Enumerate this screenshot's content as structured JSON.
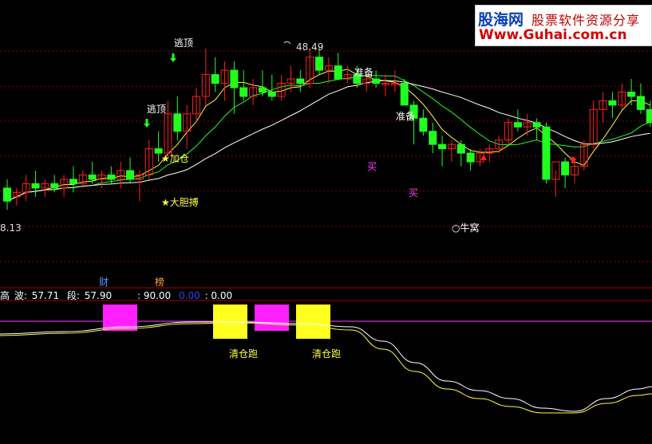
{
  "chart_data": [
    {
      "type": "candlestick",
      "title": "",
      "price_labels": {
        "high": "48.49",
        "low": "8.13"
      },
      "ylim": [
        8,
        52
      ],
      "up_color": "#ff2020",
      "down_color": "#20ff20",
      "candles": [
        [
          16,
          18,
          11,
          13
        ],
        [
          14,
          16,
          12,
          15
        ],
        [
          15,
          19,
          13,
          17
        ],
        [
          17,
          20,
          14,
          16
        ],
        [
          16,
          18,
          14,
          17
        ],
        [
          17,
          19,
          15,
          16
        ],
        [
          16,
          19,
          14,
          18
        ],
        [
          18,
          21,
          15,
          17
        ],
        [
          17,
          20,
          16,
          19
        ],
        [
          19,
          22,
          17,
          18
        ],
        [
          18,
          20,
          16,
          19
        ],
        [
          19,
          21,
          17,
          18
        ],
        [
          18,
          22,
          16,
          20
        ],
        [
          20,
          23,
          17,
          18
        ],
        [
          18,
          20,
          13,
          19
        ],
        [
          19,
          27,
          18,
          25
        ],
        [
          25,
          29,
          22,
          24
        ],
        [
          24,
          36,
          23,
          33
        ],
        [
          33,
          37,
          27,
          29
        ],
        [
          29,
          35,
          25,
          33
        ],
        [
          33,
          39,
          31,
          37
        ],
        [
          37,
          48,
          35,
          42
        ],
        [
          42,
          46,
          38,
          40
        ],
        [
          40,
          45,
          36,
          43
        ],
        [
          43,
          45,
          33,
          39
        ],
        [
          39,
          43,
          36,
          37
        ],
        [
          37,
          41,
          35,
          39
        ],
        [
          39,
          43,
          37,
          38
        ],
        [
          38,
          42,
          36,
          37
        ],
        [
          37,
          42,
          36,
          40
        ],
        [
          40,
          44,
          38,
          41
        ],
        [
          41,
          43,
          38,
          40
        ],
        [
          40,
          48,
          39,
          46
        ],
        [
          46,
          48.49,
          42,
          43
        ],
        [
          43,
          46,
          40,
          44
        ],
        [
          44,
          47,
          41,
          41
        ],
        [
          41,
          44,
          40,
          42
        ],
        [
          42,
          44,
          39,
          40
        ],
        [
          40,
          42,
          38,
          41
        ],
        [
          41,
          43,
          39,
          40
        ],
        [
          40,
          42,
          37,
          40
        ],
        [
          40,
          43,
          38,
          40
        ],
        [
          40,
          41,
          35,
          35
        ],
        [
          35,
          36,
          26,
          32
        ],
        [
          32,
          34,
          28,
          29
        ],
        [
          29,
          31,
          24,
          26
        ],
        [
          26,
          28,
          21,
          25
        ],
        [
          25,
          27,
          22,
          26
        ],
        [
          26,
          27,
          21,
          24
        ],
        [
          24,
          25,
          20,
          22
        ],
        [
          22,
          25,
          21,
          24
        ],
        [
          24,
          26,
          22,
          25
        ],
        [
          25,
          28,
          24,
          27
        ],
        [
          27,
          32,
          26,
          31
        ],
        [
          31,
          34,
          29,
          30
        ],
        [
          30,
          33,
          28,
          31
        ],
        [
          31,
          32,
          27,
          30
        ],
        [
          30,
          31,
          17,
          18
        ],
        [
          18,
          20,
          14,
          22
        ],
        [
          22,
          23,
          16,
          19
        ],
        [
          19,
          22,
          17,
          21
        ],
        [
          21,
          27,
          20,
          26
        ],
        [
          26,
          36,
          25,
          34
        ],
        [
          34,
          38,
          31,
          36
        ],
        [
          36,
          38,
          32,
          35
        ],
        [
          35,
          40,
          34,
          38
        ],
        [
          38,
          41,
          35,
          37
        ],
        [
          37,
          40,
          33,
          34
        ],
        [
          34,
          36,
          30,
          31
        ]
      ],
      "annotations": [
        {
          "text": "逃顶",
          "color": "#ffffff"
        },
        {
          "text": "逃顶",
          "color": "#ffffff"
        },
        {
          "text": "★加仓",
          "color": "#ffff40"
        },
        {
          "text": "★大胆搏",
          "color": "#ffff40"
        },
        {
          "text": "准备",
          "color": "#ffffff"
        },
        {
          "text": "准备",
          "color": "#ffffff"
        },
        {
          "text": "买",
          "color": "#ff40ff"
        },
        {
          "text": "买",
          "color": "#ff40ff"
        },
        {
          "text": "○牛窝",
          "color": "#ffffff"
        }
      ]
    },
    {
      "type": "line",
      "title": "",
      "info": {
        "prefix": "高",
        "wave_label": "波:",
        "wave_value": "57.71",
        "seg_label": "段:",
        "seg_value": "57.90",
        "v1": ": 90.00",
        "v2": "0.00",
        "v3": ": 0.00"
      },
      "top_tags": [
        {
          "text": "财",
          "color": "#40a0ff"
        },
        {
          "text": "榜",
          "color": "#ffa040"
        }
      ],
      "block_labels": [
        "清仓跑",
        "清仓跑"
      ],
      "magenta_level": 50,
      "series_colors": [
        "#ffffff",
        "#ffff40"
      ]
    }
  ],
  "watermark": {
    "brand": "股海网",
    "tagline": "股票软件资源分享",
    "url": "Www.Guhai.com.cn"
  }
}
